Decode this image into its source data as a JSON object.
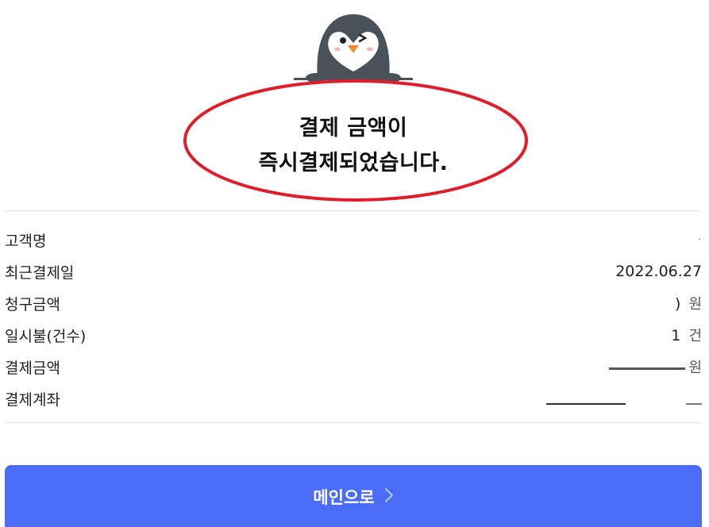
{
  "message": {
    "line1": "결제 금액이",
    "line2": "즉시결제되었습니다."
  },
  "payment_info": [
    {
      "label": "고객명",
      "value": "",
      "unit": ""
    },
    {
      "label": "최근결제일",
      "value": "2022.06.27",
      "unit": ""
    },
    {
      "label": "청구금액",
      "value": "",
      "unit": "원"
    },
    {
      "label": "일시불(건수)",
      "value": "1",
      "unit": "건"
    },
    {
      "label": "결제금액",
      "value": "",
      "unit": "원"
    },
    {
      "label": "결제계좌",
      "value": "",
      "unit": ""
    }
  ],
  "main_button": {
    "label": "메인으로"
  },
  "colors": {
    "accent": "#4a6cf7",
    "highlight_ring": "#e01e2a",
    "mascot_body": "#4b5159"
  },
  "icons": {
    "mascot": "penguin-mascot-icon",
    "button": "chevron-right-icon"
  }
}
